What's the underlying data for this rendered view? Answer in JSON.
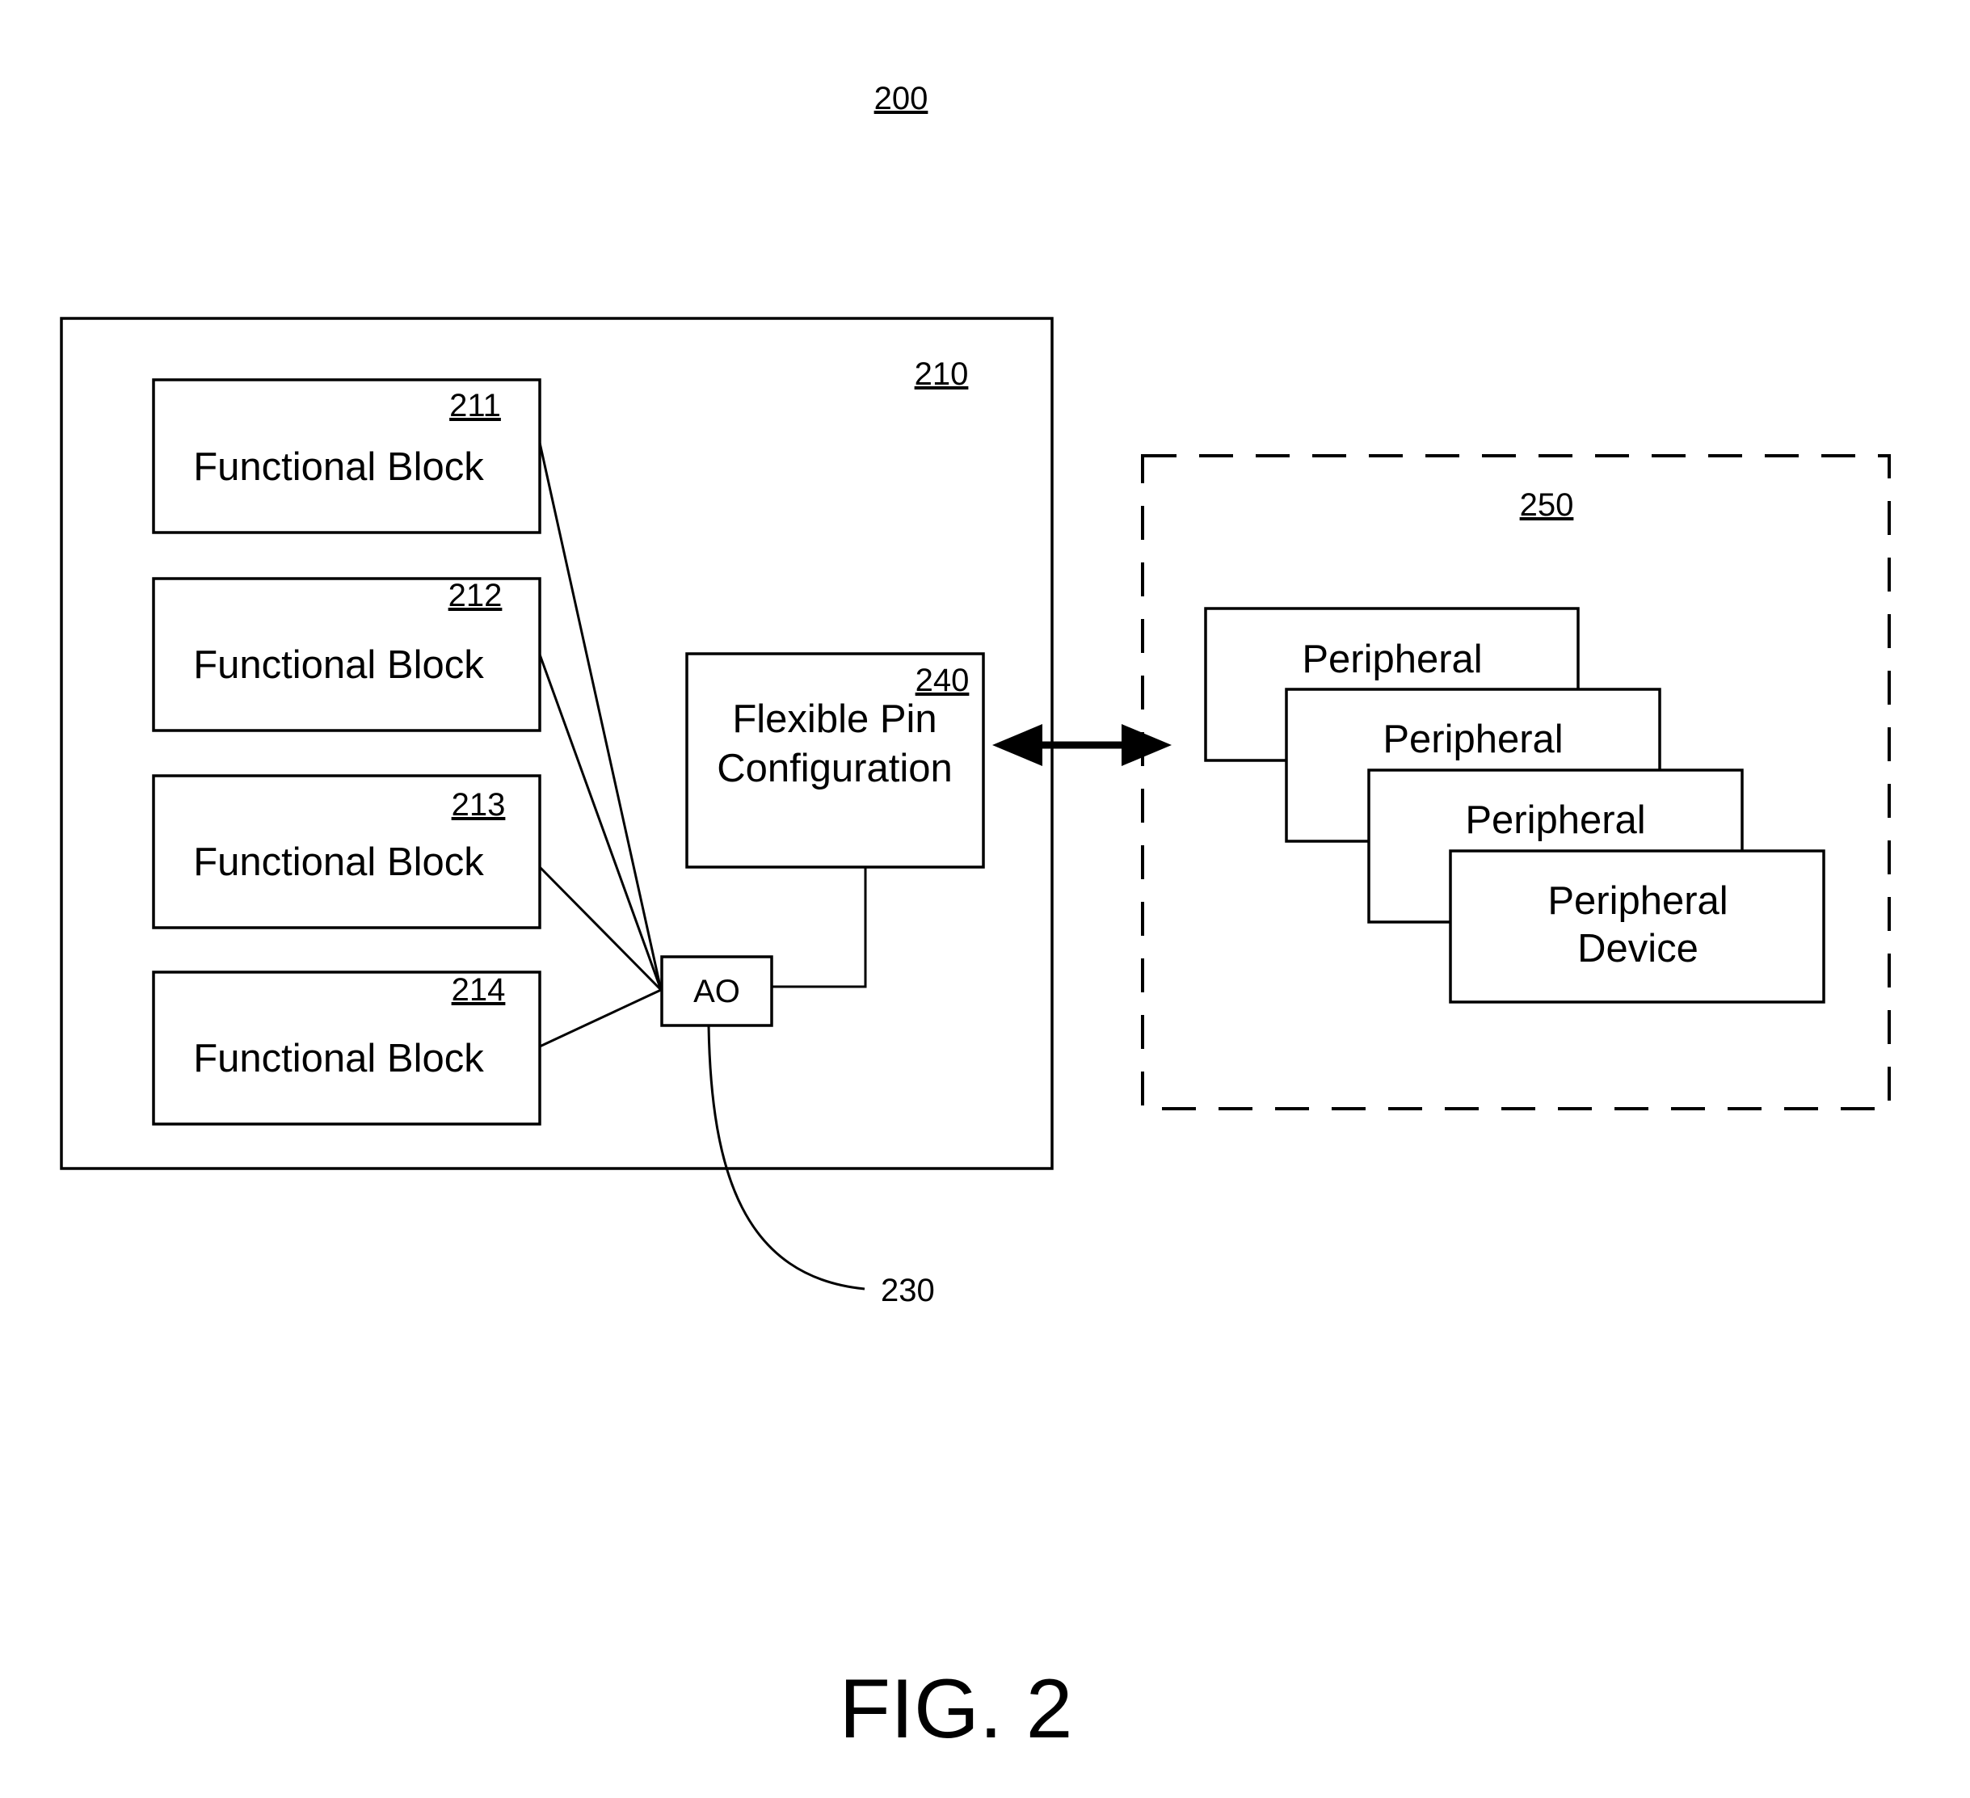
{
  "figure": {
    "number_ref": "200",
    "caption": "FIG. 2"
  },
  "device": {
    "ref": "210",
    "functional_blocks": [
      {
        "ref": "211",
        "label": "Functional Block"
      },
      {
        "ref": "212",
        "label": "Functional Block"
      },
      {
        "ref": "213",
        "label": "Functional Block"
      },
      {
        "ref": "214",
        "label": "Functional Block"
      }
    ],
    "ao": {
      "label": "AO",
      "ref": "230"
    },
    "pin_config": {
      "ref": "240",
      "label_line1": "Flexible Pin",
      "label_line2": "Configuration"
    }
  },
  "peripherals": {
    "ref": "250",
    "items": [
      {
        "label": "Peripheral"
      },
      {
        "label": "Peripheral"
      },
      {
        "label": "Peripheral"
      },
      {
        "label_line1": "Peripheral",
        "label_line2": "Device"
      }
    ]
  },
  "connection": {
    "type": "bidirectional-arrow"
  }
}
